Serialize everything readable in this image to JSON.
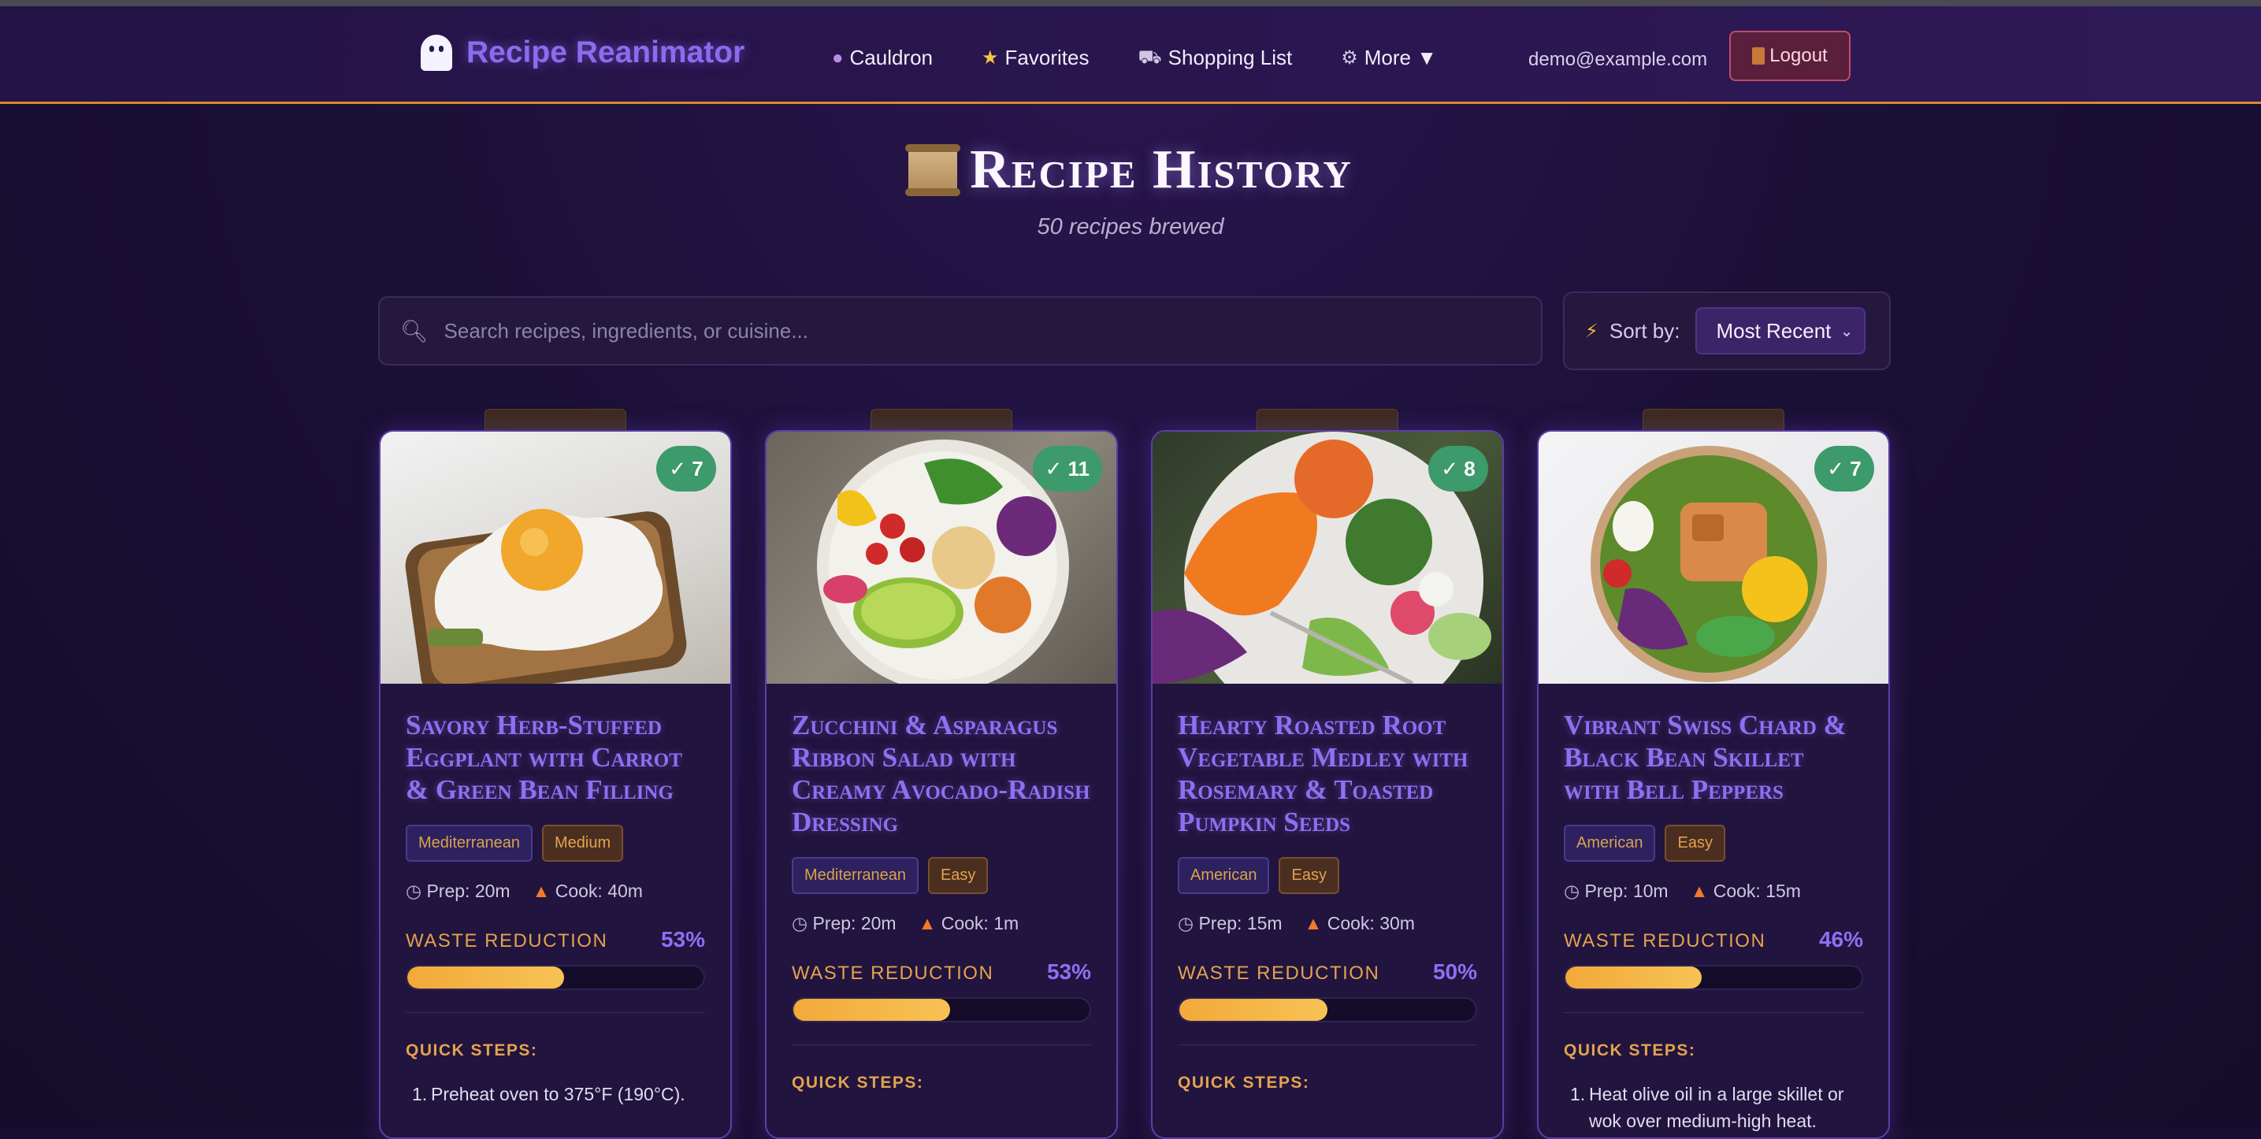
{
  "app": {
    "name": "Recipe Reanimator"
  },
  "nav": {
    "links": [
      {
        "icon": "crystal-ball-icon",
        "label": "Cauldron"
      },
      {
        "icon": "star-icon",
        "label": "Favorites"
      },
      {
        "icon": "cart-icon",
        "label": "Shopping List"
      },
      {
        "icon": "gear-icon",
        "label": "More ▼"
      }
    ],
    "user_email": "demo@example.com",
    "logout_label": "Logout"
  },
  "page": {
    "title": "Recipe History",
    "subtitle": "50 recipes brewed"
  },
  "search": {
    "placeholder": "Search recipes, ingredients, or cuisine...",
    "value": ""
  },
  "sort": {
    "label": "Sort by:",
    "selected": "Most Recent"
  },
  "labels": {
    "waste": "WASTE REDUCTION",
    "steps": "QUICK STEPS:",
    "prep_prefix": "Prep:",
    "cook_prefix": "Cook:"
  },
  "cards": [
    {
      "badge": "✓ 7",
      "title": "Savory Herb-Stuffed Eggplant with Carrot & Green Bean Filling",
      "cuisine": "Mediterranean",
      "difficulty": "Medium",
      "prep": "Prep: 20m",
      "cook": "Cook: 40m",
      "waste_pct": "53%",
      "waste_value": 53,
      "first_step": "Preheat oven to 375°F (190°C).",
      "image": "fried-egg-on-avocado-toast"
    },
    {
      "badge": "✓ 11",
      "title": "Zucchini & Asparagus Ribbon Salad with Creamy Avocado-Radish Dressing",
      "cuisine": "Mediterranean",
      "difficulty": "Easy",
      "prep": "Prep: 20m",
      "cook": "Cook: 1m",
      "waste_pct": "53%",
      "waste_value": 53,
      "first_step": "",
      "image": "buddha-bowl-with-avocado-and-chickpeas"
    },
    {
      "badge": "✓ 8",
      "title": "Hearty Roasted Root Vegetable Medley with Rosemary & Toasted Pumpkin Seeds",
      "cuisine": "American",
      "difficulty": "Easy",
      "prep": "Prep: 15m",
      "cook": "Cook: 30m",
      "waste_pct": "50%",
      "waste_value": 50,
      "first_step": "",
      "image": "colorful-vegetable-salad-plate"
    },
    {
      "badge": "✓ 7",
      "title": "Vibrant Swiss Chard & Black Bean Skillet with Bell Peppers",
      "cuisine": "American",
      "difficulty": "Easy",
      "prep": "Prep: 10m",
      "cook": "Cook: 15m",
      "waste_pct": "46%",
      "waste_value": 46,
      "first_step": "Heat olive oil in a large skillet or wok over medium-high heat.",
      "image": "salmon-poke-bowl"
    }
  ]
}
